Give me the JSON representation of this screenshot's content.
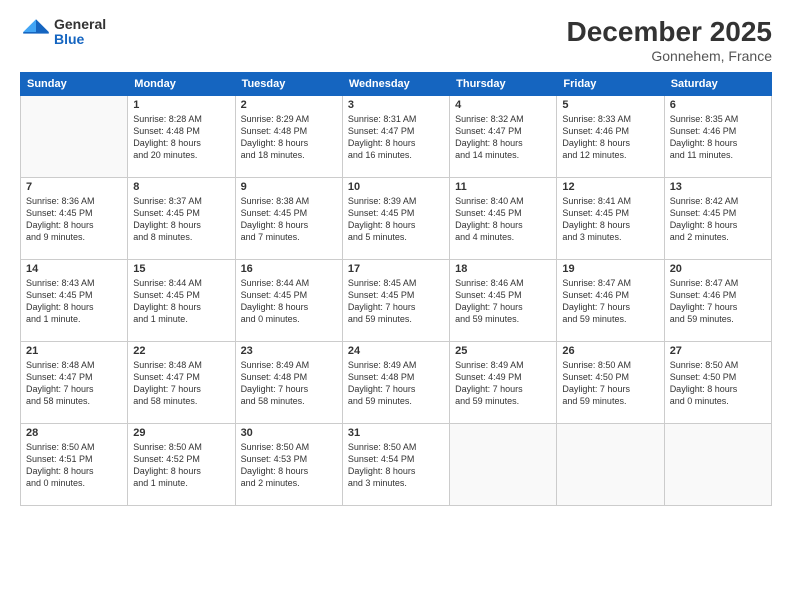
{
  "logo": {
    "general": "General",
    "blue": "Blue"
  },
  "header": {
    "month": "December 2025",
    "location": "Gonnehem, France"
  },
  "days_of_week": [
    "Sunday",
    "Monday",
    "Tuesday",
    "Wednesday",
    "Thursday",
    "Friday",
    "Saturday"
  ],
  "weeks": [
    [
      {
        "day": "",
        "info": ""
      },
      {
        "day": "1",
        "info": "Sunrise: 8:28 AM\nSunset: 4:48 PM\nDaylight: 8 hours\nand 20 minutes."
      },
      {
        "day": "2",
        "info": "Sunrise: 8:29 AM\nSunset: 4:48 PM\nDaylight: 8 hours\nand 18 minutes."
      },
      {
        "day": "3",
        "info": "Sunrise: 8:31 AM\nSunset: 4:47 PM\nDaylight: 8 hours\nand 16 minutes."
      },
      {
        "day": "4",
        "info": "Sunrise: 8:32 AM\nSunset: 4:47 PM\nDaylight: 8 hours\nand 14 minutes."
      },
      {
        "day": "5",
        "info": "Sunrise: 8:33 AM\nSunset: 4:46 PM\nDaylight: 8 hours\nand 12 minutes."
      },
      {
        "day": "6",
        "info": "Sunrise: 8:35 AM\nSunset: 4:46 PM\nDaylight: 8 hours\nand 11 minutes."
      }
    ],
    [
      {
        "day": "7",
        "info": "Sunrise: 8:36 AM\nSunset: 4:45 PM\nDaylight: 8 hours\nand 9 minutes."
      },
      {
        "day": "8",
        "info": "Sunrise: 8:37 AM\nSunset: 4:45 PM\nDaylight: 8 hours\nand 8 minutes."
      },
      {
        "day": "9",
        "info": "Sunrise: 8:38 AM\nSunset: 4:45 PM\nDaylight: 8 hours\nand 7 minutes."
      },
      {
        "day": "10",
        "info": "Sunrise: 8:39 AM\nSunset: 4:45 PM\nDaylight: 8 hours\nand 5 minutes."
      },
      {
        "day": "11",
        "info": "Sunrise: 8:40 AM\nSunset: 4:45 PM\nDaylight: 8 hours\nand 4 minutes."
      },
      {
        "day": "12",
        "info": "Sunrise: 8:41 AM\nSunset: 4:45 PM\nDaylight: 8 hours\nand 3 minutes."
      },
      {
        "day": "13",
        "info": "Sunrise: 8:42 AM\nSunset: 4:45 PM\nDaylight: 8 hours\nand 2 minutes."
      }
    ],
    [
      {
        "day": "14",
        "info": "Sunrise: 8:43 AM\nSunset: 4:45 PM\nDaylight: 8 hours\nand 1 minute."
      },
      {
        "day": "15",
        "info": "Sunrise: 8:44 AM\nSunset: 4:45 PM\nDaylight: 8 hours\nand 1 minute."
      },
      {
        "day": "16",
        "info": "Sunrise: 8:44 AM\nSunset: 4:45 PM\nDaylight: 8 hours\nand 0 minutes."
      },
      {
        "day": "17",
        "info": "Sunrise: 8:45 AM\nSunset: 4:45 PM\nDaylight: 7 hours\nand 59 minutes."
      },
      {
        "day": "18",
        "info": "Sunrise: 8:46 AM\nSunset: 4:45 PM\nDaylight: 7 hours\nand 59 minutes."
      },
      {
        "day": "19",
        "info": "Sunrise: 8:47 AM\nSunset: 4:46 PM\nDaylight: 7 hours\nand 59 minutes."
      },
      {
        "day": "20",
        "info": "Sunrise: 8:47 AM\nSunset: 4:46 PM\nDaylight: 7 hours\nand 59 minutes."
      }
    ],
    [
      {
        "day": "21",
        "info": "Sunrise: 8:48 AM\nSunset: 4:47 PM\nDaylight: 7 hours\nand 58 minutes."
      },
      {
        "day": "22",
        "info": "Sunrise: 8:48 AM\nSunset: 4:47 PM\nDaylight: 7 hours\nand 58 minutes."
      },
      {
        "day": "23",
        "info": "Sunrise: 8:49 AM\nSunset: 4:48 PM\nDaylight: 7 hours\nand 58 minutes."
      },
      {
        "day": "24",
        "info": "Sunrise: 8:49 AM\nSunset: 4:48 PM\nDaylight: 7 hours\nand 59 minutes."
      },
      {
        "day": "25",
        "info": "Sunrise: 8:49 AM\nSunset: 4:49 PM\nDaylight: 7 hours\nand 59 minutes."
      },
      {
        "day": "26",
        "info": "Sunrise: 8:50 AM\nSunset: 4:50 PM\nDaylight: 7 hours\nand 59 minutes."
      },
      {
        "day": "27",
        "info": "Sunrise: 8:50 AM\nSunset: 4:50 PM\nDaylight: 8 hours\nand 0 minutes."
      }
    ],
    [
      {
        "day": "28",
        "info": "Sunrise: 8:50 AM\nSunset: 4:51 PM\nDaylight: 8 hours\nand 0 minutes."
      },
      {
        "day": "29",
        "info": "Sunrise: 8:50 AM\nSunset: 4:52 PM\nDaylight: 8 hours\nand 1 minute."
      },
      {
        "day": "30",
        "info": "Sunrise: 8:50 AM\nSunset: 4:53 PM\nDaylight: 8 hours\nand 2 minutes."
      },
      {
        "day": "31",
        "info": "Sunrise: 8:50 AM\nSunset: 4:54 PM\nDaylight: 8 hours\nand 3 minutes."
      },
      {
        "day": "",
        "info": ""
      },
      {
        "day": "",
        "info": ""
      },
      {
        "day": "",
        "info": ""
      }
    ]
  ]
}
